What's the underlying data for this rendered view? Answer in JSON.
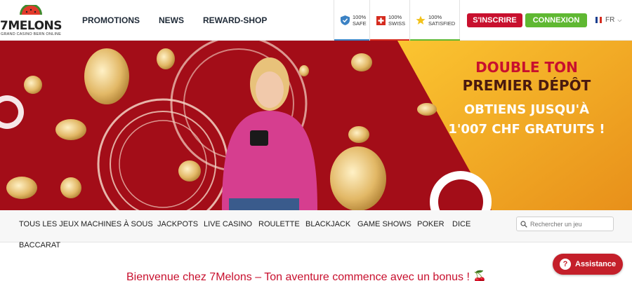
{
  "header": {
    "logo": {
      "name": "7MELONS",
      "tagline": "GRAND CASINO BERN ONLINE"
    },
    "nav": [
      "PROMOTIONS",
      "NEWS",
      "REWARD-SHOP"
    ],
    "trust": [
      {
        "label": "100%\nSAFE",
        "icon": "shield-check-icon",
        "color": "#3b82c4"
      },
      {
        "label": "100%\nSWISS",
        "icon": "swiss-flag-icon",
        "color": "#d52b1e"
      },
      {
        "label": "100%\nSATISFIED",
        "icon": "star-icon",
        "color": "#f2c21b"
      }
    ],
    "signup_label": "S'INSCRIRE",
    "login_label": "CONNEXION",
    "language": "FR"
  },
  "banner": {
    "line1": "DOUBLE TON",
    "line2": "PREMIER DÉPÔT",
    "line3": "OBTIENS JUSQU'À",
    "line4": "1'007 CHF GRATUITS !"
  },
  "categories": [
    "TOUS LES JEUX",
    "MACHINES À SOUS",
    "JACKPOTS",
    "LIVE CASINO",
    "ROULETTE",
    "BLACKJACK",
    "GAME SHOWS",
    "POKER",
    "DICE"
  ],
  "category_wrap": "BACCARAT",
  "search": {
    "placeholder": "Rechercher un jeu"
  },
  "welcome": "Bienvenue chez 7Melons – Ton aventure commence avec un bonus ! 🍒",
  "assist": {
    "label": "Assistance"
  },
  "colors": {
    "brand_red": "#c8102e",
    "green": "#5fb832",
    "banner_red": "#a30d18",
    "banner_gold": "#f6b81a"
  }
}
